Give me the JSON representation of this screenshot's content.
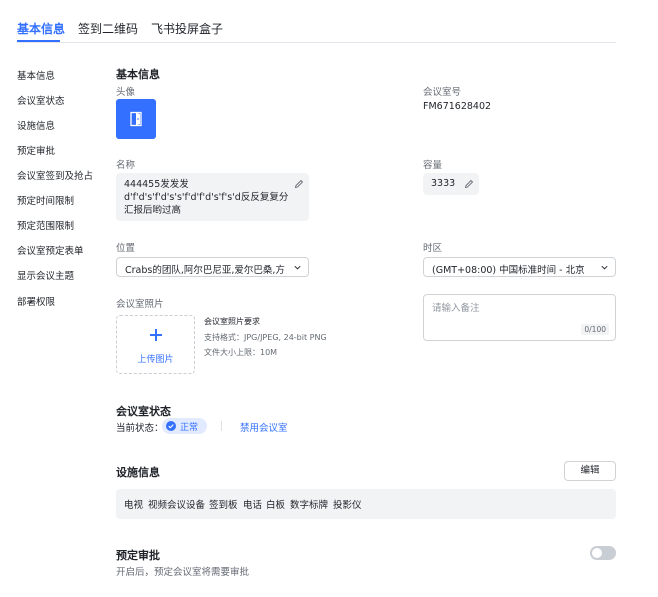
{
  "tabs": [
    "基本信息",
    "签到二维码",
    "飞书投屏盒子"
  ],
  "sidebar": {
    "items": [
      {
        "label": "基本信息"
      },
      {
        "label": "会议室状态"
      },
      {
        "label": "设施信息"
      },
      {
        "label": "预定审批"
      },
      {
        "label": "会议室签到及抢占"
      },
      {
        "label": "预定时间限制"
      },
      {
        "label": "预定范围限制"
      },
      {
        "label": "会议室预定表单"
      },
      {
        "label": "显示会议主题"
      },
      {
        "label": "部署权限"
      }
    ]
  },
  "basic": {
    "title": "基本信息",
    "avatar_label": "头像",
    "room_no_label": "会议室号",
    "room_no": "FM671628402",
    "name_label": "名称",
    "name_value": "444455发发发 d'f'd's'f'd's's'f'd'f'd's'f's'd反反复复分汇报后哟过高",
    "capacity_label": "容量",
    "capacity_value": "3333",
    "location_label": "位置",
    "location_value": "Crabs的团队,阿尔巴尼亚,爱尔巴桑,方...",
    "timezone_label": "时区",
    "timezone_value": "(GMT+08:00) 中国标准时间 - 北京",
    "photo_label": "会议室照片",
    "upload_label": "上传图片",
    "photo_req_title": "会议室照片要求",
    "photo_req_format": "支持格式：JPG/JPEG, 24-bit PNG",
    "photo_req_size": "文件大小上限：10M",
    "remark_placeholder": "请输入备注",
    "remark_counter": "0/100"
  },
  "status": {
    "title": "会议室状态",
    "current_label": "当前状态：",
    "current_value": "正常",
    "disable_link": "禁用会议室"
  },
  "facility": {
    "title": "设施信息",
    "edit_label": "编辑",
    "items": [
      "电视",
      "视频会议设备",
      "签到板",
      "电话",
      "白板",
      "数字标牌",
      "投影仪"
    ]
  },
  "approval": {
    "title": "预定审批",
    "desc": "开启后，预定会议室将需要审批",
    "enabled": false
  },
  "colors": {
    "accent": "#3370ff",
    "text": "#1f2329",
    "muted": "#646a73"
  }
}
